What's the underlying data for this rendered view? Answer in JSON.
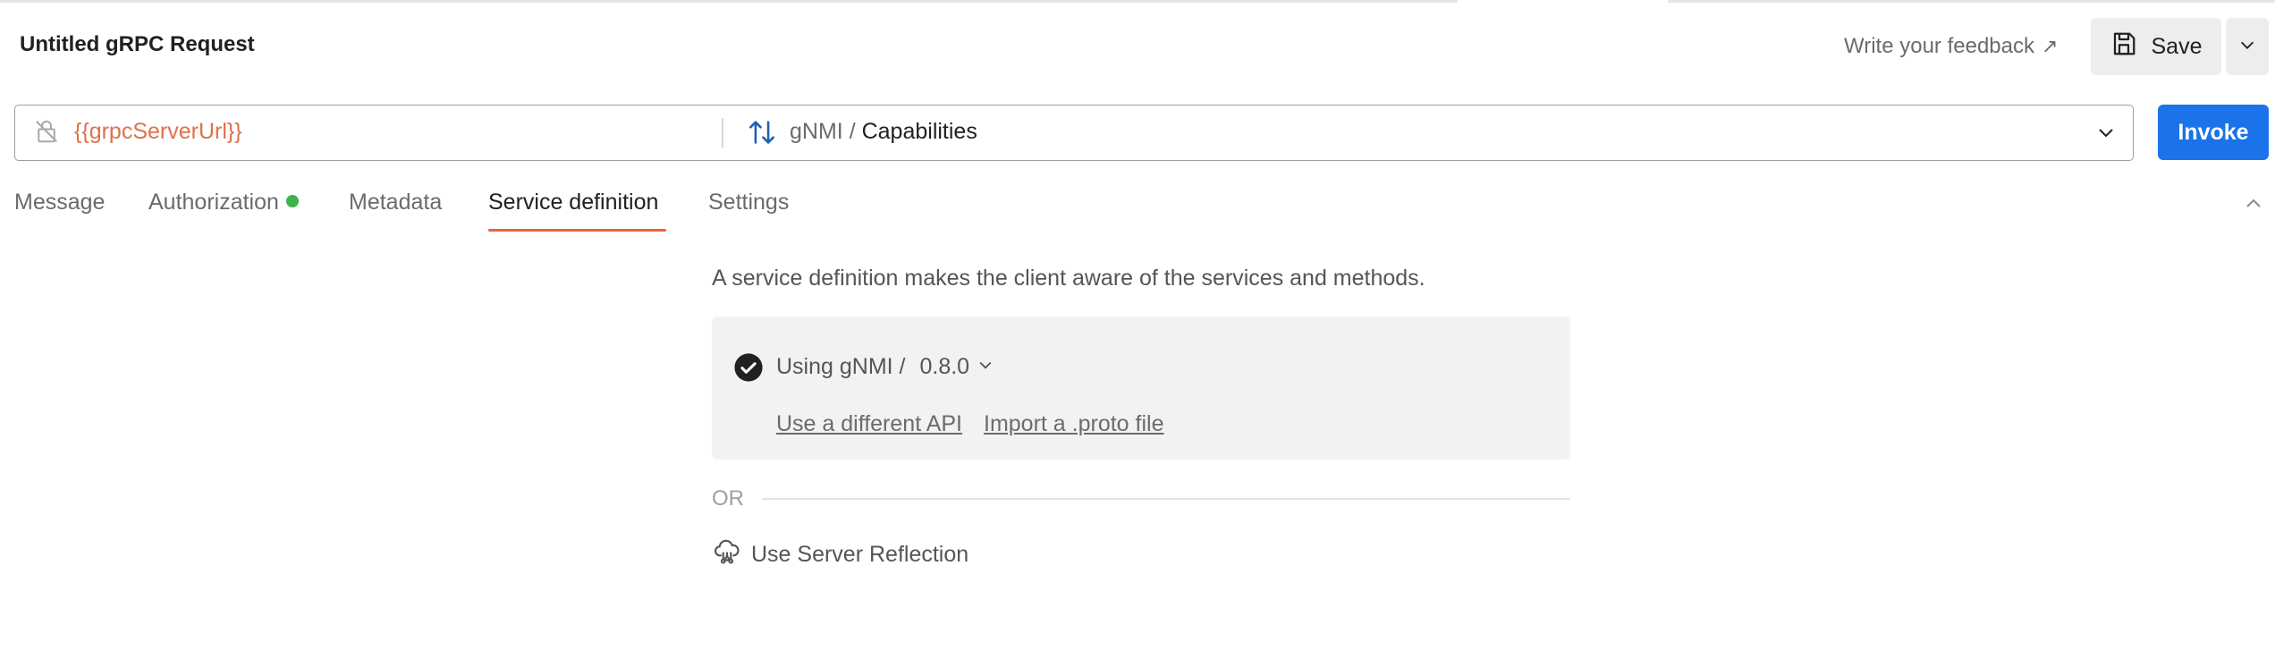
{
  "header": {
    "title": "Untitled gRPC Request",
    "feedback_label": "Write your feedback",
    "feedback_icon": "external-arrow-icon",
    "save_label": "Save"
  },
  "urlbar": {
    "url": "{{grpcServerUrl}}",
    "service": "gNMI",
    "separator": "/",
    "method": "Capabilities"
  },
  "invoke_label": "Invoke",
  "tabs": [
    {
      "label": "Message"
    },
    {
      "label": "Authorization",
      "status": "green-dot"
    },
    {
      "label": "Metadata"
    },
    {
      "label": "Service definition",
      "active": true
    },
    {
      "label": "Settings"
    }
  ],
  "service_definition": {
    "description": "A service definition makes the client aware of the services and methods.",
    "using_label": "Using gNMI /",
    "version": "0.8.0",
    "link_different_api": "Use a different API",
    "link_import_proto": "Import a .proto file",
    "or_label": "OR",
    "reflection_label": "Use Server Reflection"
  },
  "colors": {
    "accent": "#1a73e8",
    "tab_underline": "#e8643a",
    "variable": "#e0714a",
    "status_green": "#3bb44a"
  }
}
